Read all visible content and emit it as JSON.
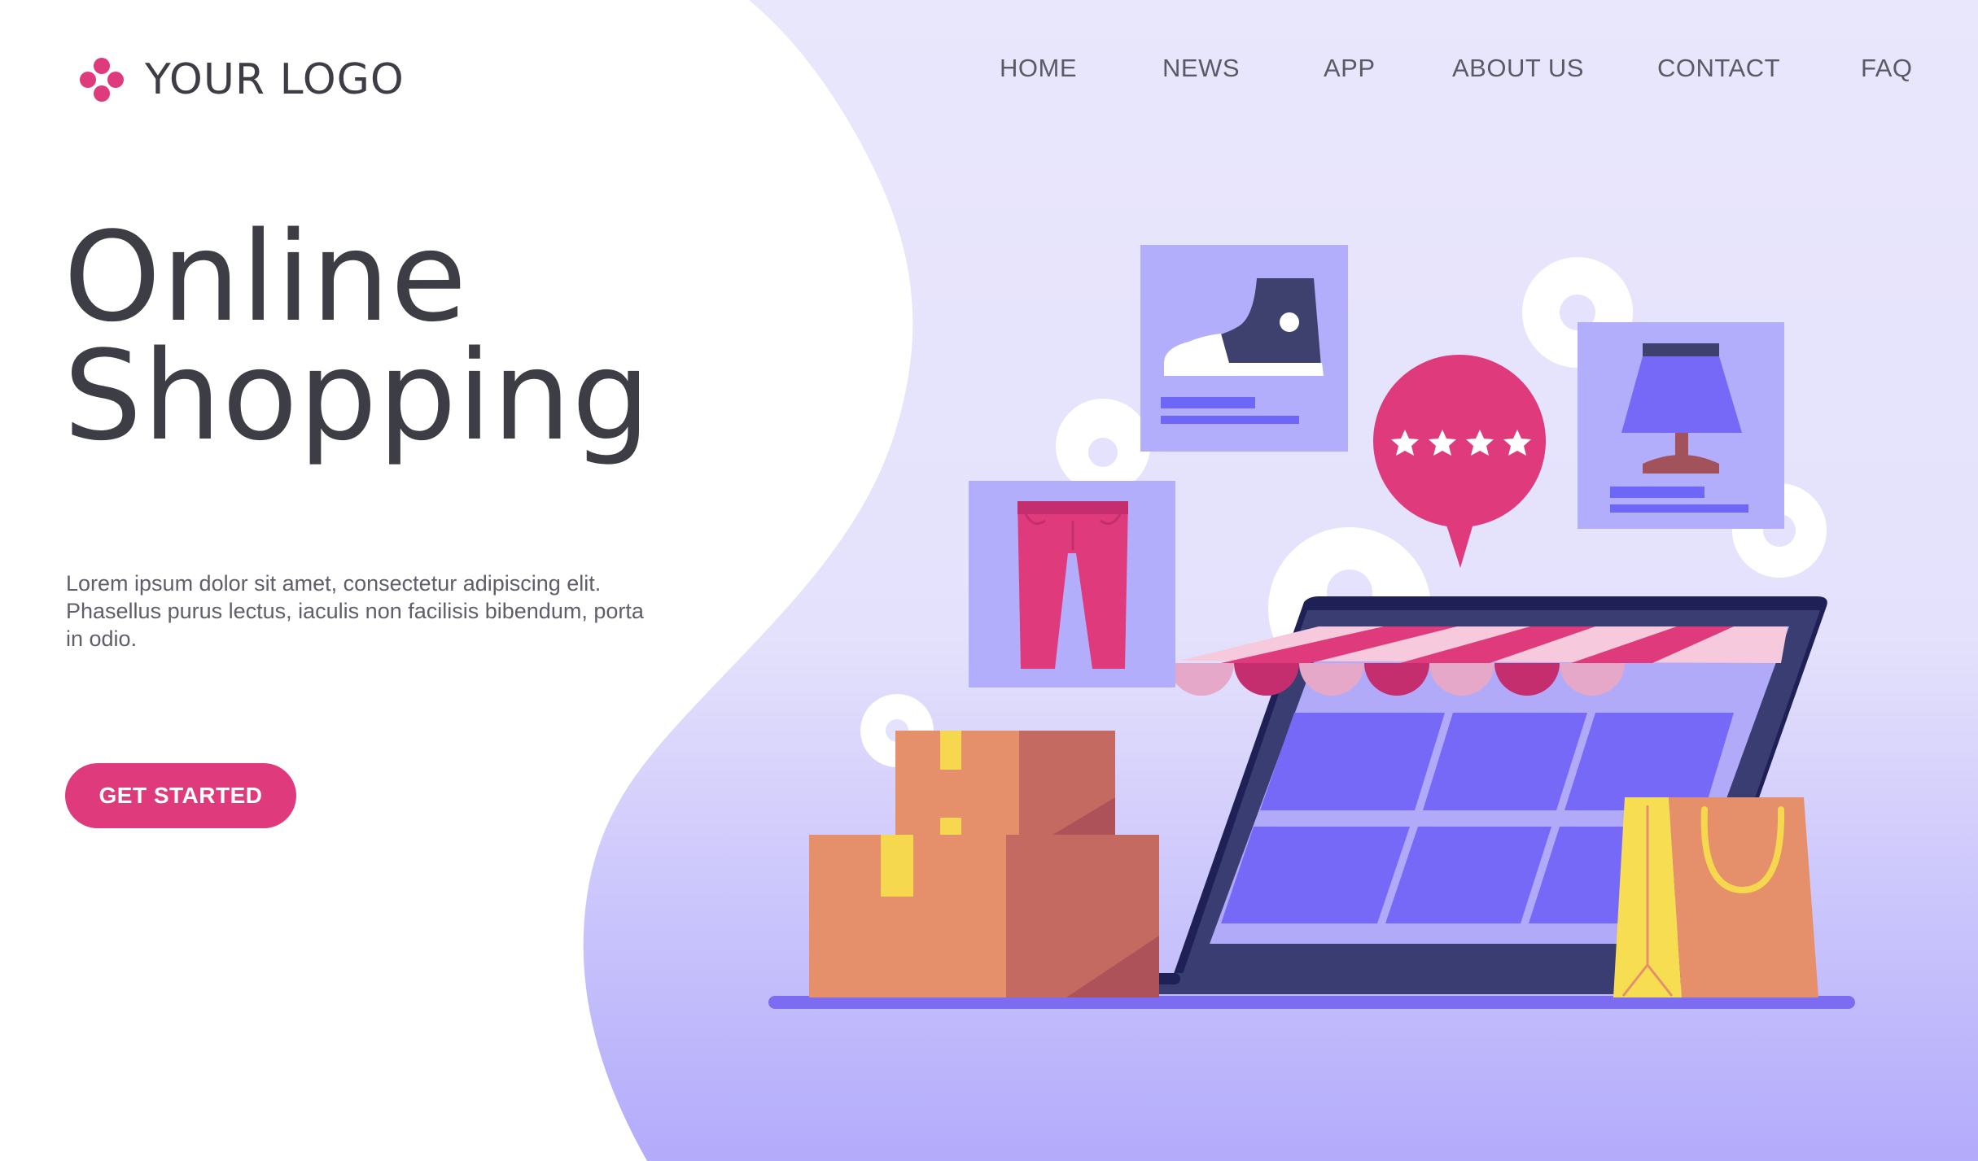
{
  "brand": {
    "logo_text": "YOUR LOGO",
    "logo_icon": "four-dot-flower-icon",
    "accent": "#df3a7c"
  },
  "nav": {
    "items": [
      "HOME",
      "NEWS",
      "APP",
      "ABOUT US",
      "CONTACT",
      "FAQ"
    ]
  },
  "hero": {
    "title_line1": "Online",
    "title_line2": "Shopping",
    "description": "Lorem ipsum dolor sit amet, consectetur adipiscing elit. Phasellus purus lectus, iaculis non facilisis bibendum, porta in odio.",
    "cta_label": "GET STARTED"
  },
  "illustration": {
    "items": [
      "sneaker-card",
      "pants-card",
      "lamp-card",
      "rating-bubble",
      "laptop-storefront",
      "cardboard-boxes",
      "shopping-bag"
    ],
    "rating_stars": 4
  },
  "colors": {
    "background_blob": "#e8e6fc",
    "purple": "#7b6cff",
    "dark_navy": "#2a2c62",
    "text": "#3d3d45"
  }
}
